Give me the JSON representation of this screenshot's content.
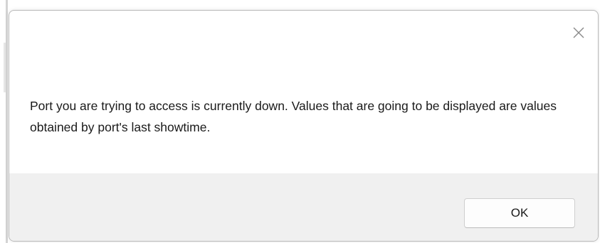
{
  "dialog": {
    "message": "Port you are trying to access is currently down. Values that are going to be displayed are values obtained by port's last showtime.",
    "close_icon": "close-icon",
    "buttons": {
      "ok_label": "OK"
    }
  },
  "colors": {
    "dialog_background": "#ffffff",
    "footer_background": "#f0f0f0",
    "button_background": "#fdfdfd",
    "text": "#1a1a1a",
    "close_icon": "#8a8a8a"
  }
}
